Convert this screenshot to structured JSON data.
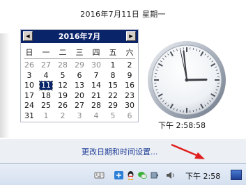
{
  "header": {
    "date_text": "2016年7月11日 星期一"
  },
  "calendar": {
    "month_title": "2016年7月",
    "prev_symbol": "◀",
    "next_symbol": "▶",
    "weekdays": [
      "日",
      "一",
      "二",
      "三",
      "四",
      "五",
      "六"
    ],
    "selected_day": "11",
    "weeks": [
      [
        {
          "d": "26",
          "o": true
        },
        {
          "d": "27",
          "o": true
        },
        {
          "d": "28",
          "o": true
        },
        {
          "d": "29",
          "o": true
        },
        {
          "d": "30",
          "o": true
        },
        {
          "d": "1",
          "o": false
        },
        {
          "d": "2",
          "o": false
        }
      ],
      [
        {
          "d": "3",
          "o": false
        },
        {
          "d": "4",
          "o": false
        },
        {
          "d": "5",
          "o": false
        },
        {
          "d": "6",
          "o": false
        },
        {
          "d": "7",
          "o": false
        },
        {
          "d": "8",
          "o": false
        },
        {
          "d": "9",
          "o": false
        }
      ],
      [
        {
          "d": "10",
          "o": false
        },
        {
          "d": "11",
          "o": false,
          "today": true
        },
        {
          "d": "12",
          "o": false
        },
        {
          "d": "13",
          "o": false
        },
        {
          "d": "14",
          "o": false
        },
        {
          "d": "15",
          "o": false
        },
        {
          "d": "16",
          "o": false
        }
      ],
      [
        {
          "d": "17",
          "o": false
        },
        {
          "d": "18",
          "o": false
        },
        {
          "d": "19",
          "o": false
        },
        {
          "d": "20",
          "o": false
        },
        {
          "d": "21",
          "o": false
        },
        {
          "d": "22",
          "o": false
        },
        {
          "d": "23",
          "o": false
        }
      ],
      [
        {
          "d": "24",
          "o": false
        },
        {
          "d": "25",
          "o": false
        },
        {
          "d": "26",
          "o": false
        },
        {
          "d": "27",
          "o": false
        },
        {
          "d": "28",
          "o": false
        },
        {
          "d": "29",
          "o": false
        },
        {
          "d": "30",
          "o": false
        }
      ],
      [
        {
          "d": "31",
          "o": false
        },
        {
          "d": "1",
          "o": true
        },
        {
          "d": "2",
          "o": true
        },
        {
          "d": "3",
          "o": true
        },
        {
          "d": "4",
          "o": true
        },
        {
          "d": "5",
          "o": true
        },
        {
          "d": "6",
          "o": true
        }
      ]
    ]
  },
  "clock": {
    "time_text": "下午 2:58:58",
    "hour": 2,
    "minute": 58,
    "second": 58
  },
  "footer": {
    "settings_link": "更改日期和时间设置..."
  },
  "taskbar": {
    "time_text": "下午 2:58",
    "tray_icons": [
      "keyboard-icon",
      "network-app-icon",
      "qq-icon",
      "wechat-icon",
      "power-icon",
      "volume-icon"
    ]
  },
  "colors": {
    "calendar_header": "#0a246a",
    "link": "#1f3f99",
    "arrow": "#e02020"
  }
}
